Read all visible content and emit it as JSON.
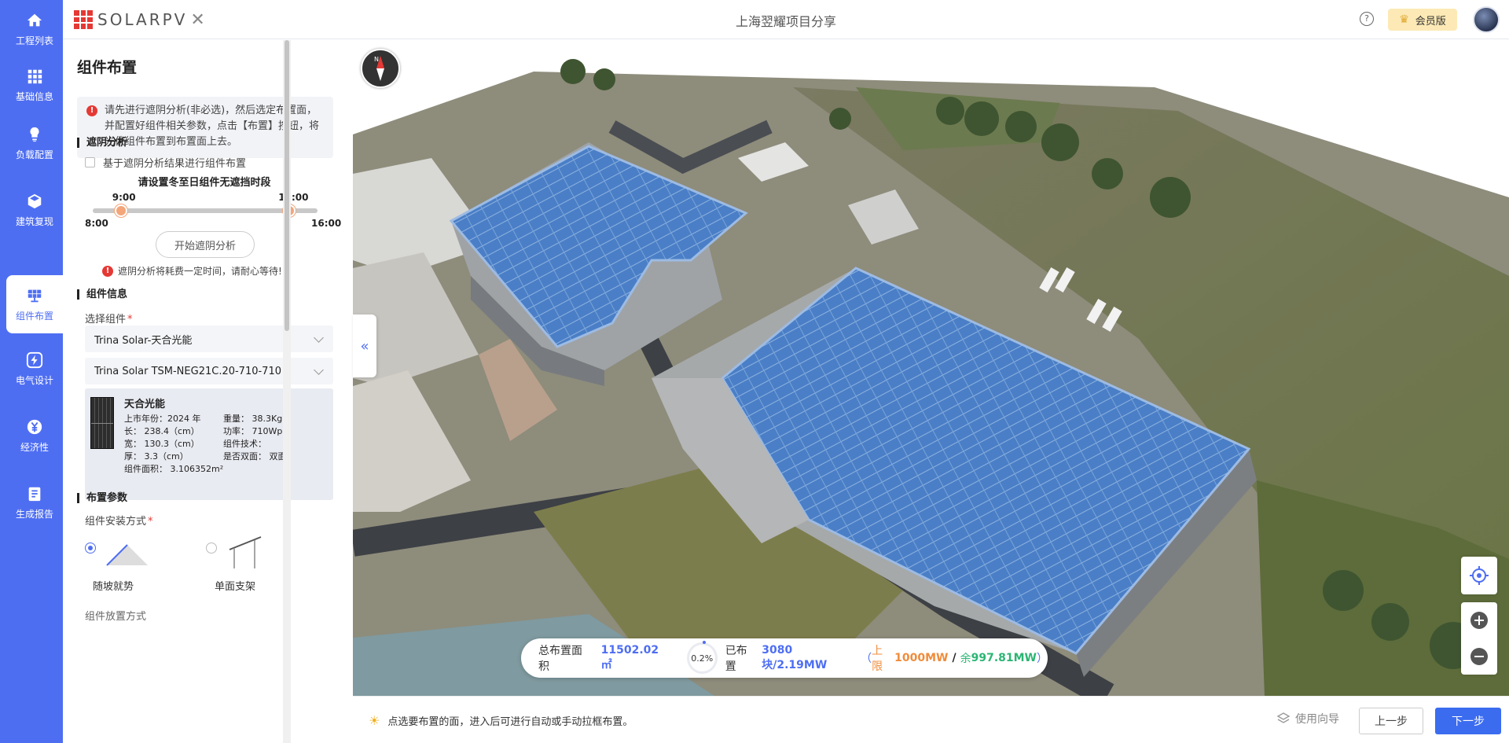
{
  "nav": {
    "items": [
      {
        "label": "工程列表",
        "icon": "home-icon"
      },
      {
        "label": "基础信息",
        "icon": "grid-icon"
      },
      {
        "label": "负载配置",
        "icon": "bulb-icon"
      },
      {
        "label": "建筑复现",
        "icon": "cube-icon"
      },
      {
        "label": "组件布置",
        "icon": "solar-panel-icon",
        "active": true
      },
      {
        "label": "电气设计",
        "icon": "lightning-icon"
      },
      {
        "label": "经济性",
        "icon": "yen-icon"
      },
      {
        "label": "生成报告",
        "icon": "report-icon"
      }
    ],
    "accent": "#4e6ef2"
  },
  "header": {
    "logo_text": "SOLARPV",
    "project_title": "上海翌耀项目分享",
    "help_icon": "question-icon",
    "vip_label": "会员版"
  },
  "panel": {
    "title": "组件布置",
    "tip": "请先进行遮阴分析(非必选)，然后选定布置面，并配置好组件相关参数，点击【布置】按钮，将光伏组件布置到布置面上去。",
    "shading": {
      "section_title": "遮阴分析",
      "checkbox_label": "基于遮阴分析结果进行组件布置",
      "checkbox_checked": false,
      "slider_caption": "请设置冬至日组件无遮挡时段",
      "range_min_label": "8:00",
      "range_max_label": "16:00",
      "start_label": "9:00",
      "end_label": "15:00",
      "range_min": 8,
      "range_max": 16,
      "start_value": 9,
      "end_value": 15,
      "button_label": "开始遮阴分析",
      "warning": "遮阴分析将耗费一定时间，请耐心等待!"
    },
    "module": {
      "section_title": "组件信息",
      "select_label": "选择组件",
      "manufacturer": "Trina Solar-天合光能",
      "model": "Trina Solar TSM-NEG21C.20-710-710",
      "card": {
        "name": "天合光能",
        "year": "上市年份：2024 年",
        "weight": "重量：  38.3Kg",
        "length": "长：  238.4（cm）",
        "power": "功率：  710Wp",
        "width": "宽：  130.3（cm）",
        "tech": "组件技术：",
        "thickness": "厚：  3.3（cm）",
        "bifacial": "是否双面：  双面",
        "area": "组件面积：  3.106352m²"
      }
    },
    "layout": {
      "section_title": "布置参数",
      "mount_label": "组件安装方式",
      "options": [
        "随坡就势",
        "单面支架"
      ],
      "selected": 0,
      "next_label": "组件放置方式"
    }
  },
  "stats": {
    "area_label": "总布置面积",
    "area_value": "11502.02 ㎡",
    "percent": "0.2%",
    "placed_label": "已布置",
    "placed_value": "3080块/2.19MW",
    "open_paren": "（",
    "limit_label": "上限",
    "limit_value": "1000MW",
    "slash": "/",
    "remain_label": "余",
    "remain_value": "997.81MW",
    "close_paren": "）"
  },
  "bottom": {
    "tip": "点选要布置的面，进入后可进行自动或手动拉框布置。",
    "guide_label": "使用向导",
    "prev_label": "上一步",
    "next_label": "下一步"
  },
  "colors": {
    "solar_blue": "#4a7fc7",
    "limit_orange": "#f08c3b",
    "remain_green": "#2bb673",
    "stats_blue": "#4e6ef2"
  }
}
